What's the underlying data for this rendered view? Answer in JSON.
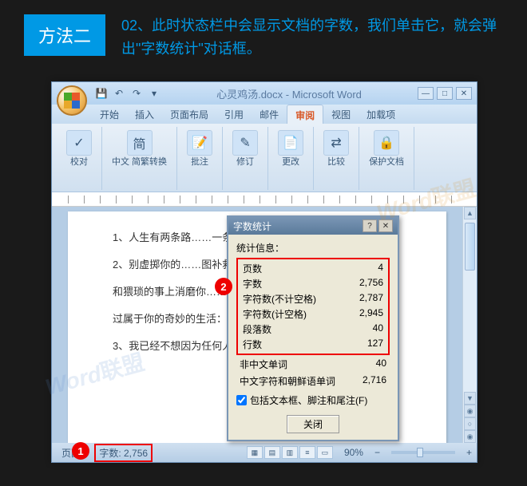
{
  "header": {
    "badge": "方法二",
    "text": "02、此时状态栏中会显示文档的字数，我们单击它，就会弹出\"字数统计\"对话框。"
  },
  "window": {
    "title": "心灵鸡汤.docx - Microsoft Word",
    "tabs": [
      "开始",
      "插入",
      "页面布局",
      "引用",
      "邮件",
      "审阅",
      "视图",
      "加载项"
    ],
    "active_tab_index": 5,
    "ribbon_groups": [
      {
        "icon": "✓",
        "label": "校对"
      },
      {
        "icon": "简",
        "label": "中文\n简繁转换"
      },
      {
        "icon": "📝",
        "label": "批注"
      },
      {
        "icon": "✎",
        "label": "修订"
      },
      {
        "icon": "📄",
        "label": "更改"
      },
      {
        "icon": "⇄",
        "label": "比较"
      },
      {
        "icon": "🔒",
        "label": "保护文档"
      }
    ],
    "document_lines": [
      "1、人生有两条路……一条需要用脚走，叫做",
      "2、别虚掷你的……图补救无望的过失，别",
      "和猥琐的事上消磨你……代病态的目标和虚假的理",
      "过属于你的奇妙的生活：点滴都别浪费。",
      "3、我已经不想因为任何人产生任何情绪上的失控。"
    ],
    "statusbar": {
      "page_label": "页面:",
      "page_value": "",
      "word_count_label": "字数: 2,756",
      "zoom": "90%"
    }
  },
  "dialog": {
    "title": "字数统计",
    "stats_label": "统计信息：",
    "stats": [
      {
        "label": "页数",
        "value": "4"
      },
      {
        "label": "字数",
        "value": "2,756"
      },
      {
        "label": "字符数(不计空格)",
        "value": "2,787"
      },
      {
        "label": "字符数(计空格)",
        "value": "2,945"
      },
      {
        "label": "段落数",
        "value": "40"
      },
      {
        "label": "行数",
        "value": "127"
      }
    ],
    "extra": [
      {
        "label": "非中文单词",
        "value": "40"
      },
      {
        "label": "中文字符和朝鲜语单词",
        "value": "2,716"
      }
    ],
    "checkbox_label": "包括文本框、脚注和尾注(F)",
    "close_btn": "关闭"
  },
  "callouts": {
    "c1": "1",
    "c2": "2"
  },
  "watermark": {
    "en": "Word",
    "cn": "联盟"
  }
}
